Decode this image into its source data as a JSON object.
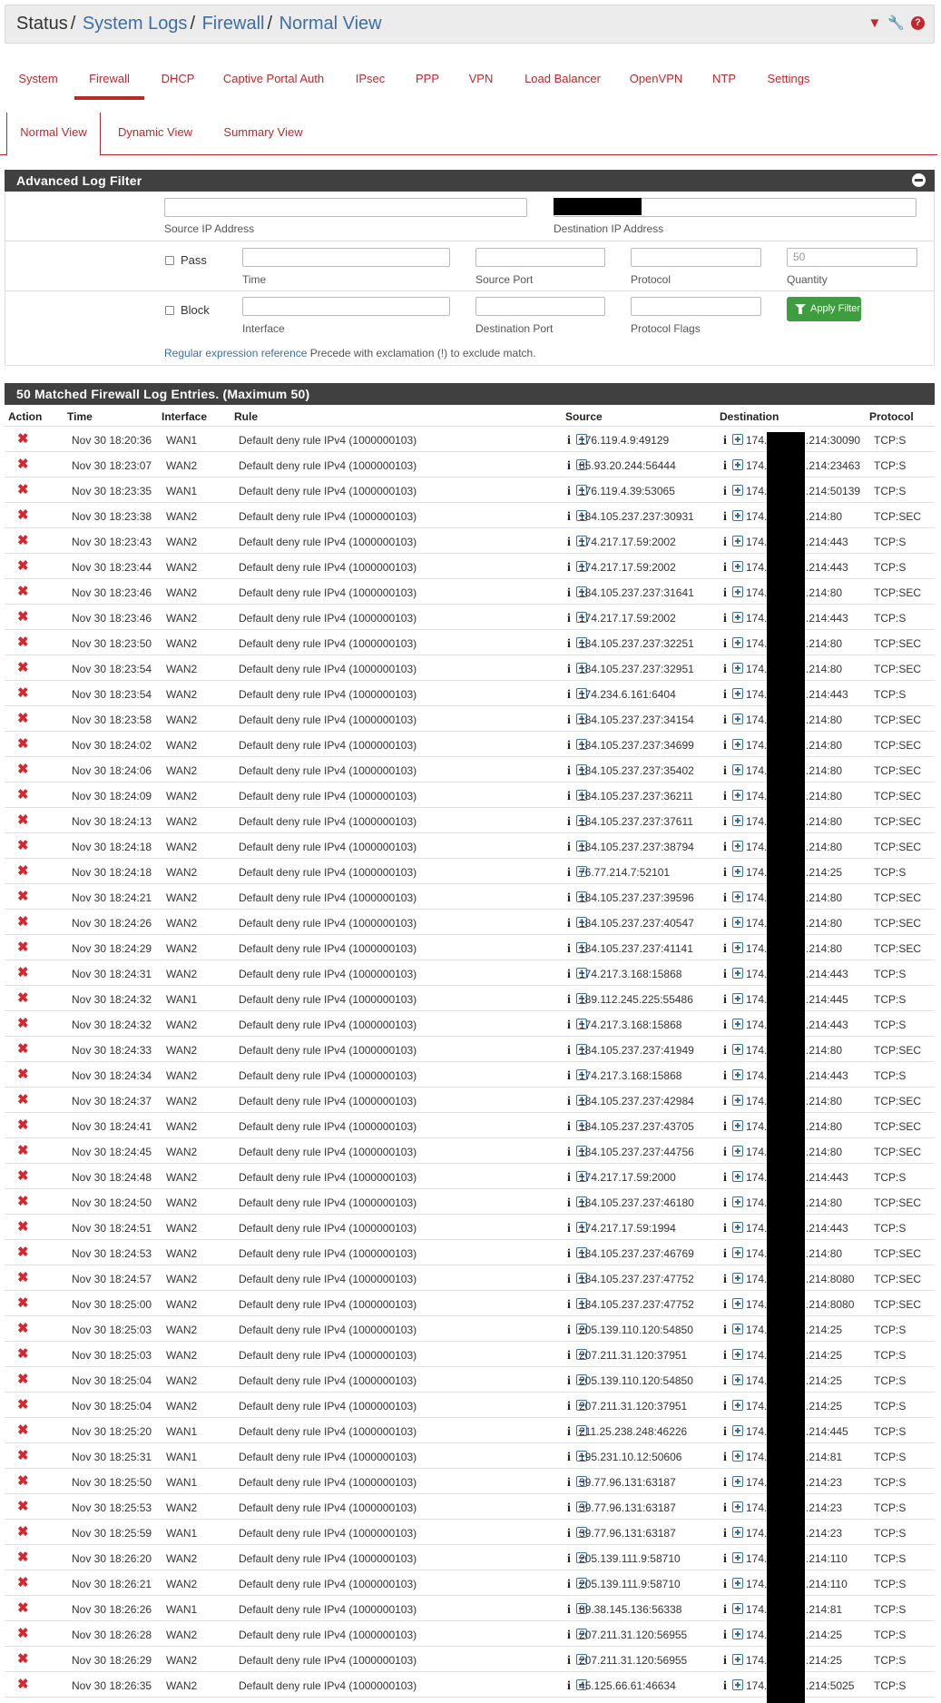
{
  "breadcrumb": {
    "status": "Status",
    "system_logs": "System Logs",
    "firewall": "Firewall",
    "normal_view": "Normal View"
  },
  "header_icons": [
    "filter-icon",
    "wrench-icon",
    "help-icon"
  ],
  "tabs": [
    "System",
    "Firewall",
    "DHCP",
    "Captive Portal Auth",
    "IPsec",
    "PPP",
    "VPN",
    "Load Balancer",
    "OpenVPN",
    "NTP",
    "Settings"
  ],
  "active_tab": "Firewall",
  "subtabs": [
    "Normal View",
    "Dynamic View",
    "Summary View"
  ],
  "active_subtab": "Normal View",
  "filter": {
    "title": "Advanced Log Filter",
    "source_ip_label": "Source IP Address",
    "destination_ip_label": "Destination IP Address",
    "pass_label": "Pass",
    "block_label": "Block",
    "time_label": "Time",
    "source_port_label": "Source Port",
    "protocol_label": "Protocol",
    "quantity_label": "Quantity",
    "quantity_placeholder": "50",
    "interface_label": "Interface",
    "destination_port_label": "Destination Port",
    "protocol_flags_label": "Protocol Flags",
    "apply_button": "Apply Filter",
    "regex_link": "Regular expression reference",
    "regex_hint": "Precede with exclamation (!) to exclude match."
  },
  "log": {
    "title": "50 Matched Firewall Log Entries. (Maximum 50)",
    "columns": [
      "Action",
      "Time",
      "Interface",
      "Rule",
      "Source",
      "Destination",
      "Protocol"
    ],
    "entries": [
      {
        "time": "Nov 30 18:20:36",
        "iface": "WAN1",
        "rule": "Default deny rule IPv4 (1000000103)",
        "src": "176.119.4.9:49129",
        "dst_prefix": "174.",
        "dst_suffix": ".214:30090",
        "proto": "TCP:S"
      },
      {
        "time": "Nov 30 18:23:07",
        "iface": "WAN2",
        "rule": "Default deny rule IPv4 (1000000103)",
        "src": "85.93.20.244:56444",
        "dst_prefix": "174.",
        "dst_suffix": ".214:23463",
        "proto": "TCP:S"
      },
      {
        "time": "Nov 30 18:23:35",
        "iface": "WAN1",
        "rule": "Default deny rule IPv4 (1000000103)",
        "src": "176.119.4.39:53065",
        "dst_prefix": "174.",
        "dst_suffix": ".214:50139",
        "proto": "TCP:S"
      },
      {
        "time": "Nov 30 18:23:38",
        "iface": "WAN2",
        "rule": "Default deny rule IPv4 (1000000103)",
        "src": "184.105.237.237:30931",
        "dst_prefix": "174.",
        "dst_suffix": ".214:80",
        "proto": "TCP:SEC"
      },
      {
        "time": "Nov 30 18:23:43",
        "iface": "WAN2",
        "rule": "Default deny rule IPv4 (1000000103)",
        "src": "174.217.17.59:2002",
        "dst_prefix": "174.",
        "dst_suffix": ".214:443",
        "proto": "TCP:S"
      },
      {
        "time": "Nov 30 18:23:44",
        "iface": "WAN2",
        "rule": "Default deny rule IPv4 (1000000103)",
        "src": "174.217.17.59:2002",
        "dst_prefix": "174.",
        "dst_suffix": ".214:443",
        "proto": "TCP:S"
      },
      {
        "time": "Nov 30 18:23:46",
        "iface": "WAN2",
        "rule": "Default deny rule IPv4 (1000000103)",
        "src": "184.105.237.237:31641",
        "dst_prefix": "174.",
        "dst_suffix": ".214:80",
        "proto": "TCP:SEC"
      },
      {
        "time": "Nov 30 18:23:46",
        "iface": "WAN2",
        "rule": "Default deny rule IPv4 (1000000103)",
        "src": "174.217.17.59:2002",
        "dst_prefix": "174.",
        "dst_suffix": ".214:443",
        "proto": "TCP:S"
      },
      {
        "time": "Nov 30 18:23:50",
        "iface": "WAN2",
        "rule": "Default deny rule IPv4 (1000000103)",
        "src": "184.105.237.237:32251",
        "dst_prefix": "174.",
        "dst_suffix": ".214:80",
        "proto": "TCP:SEC"
      },
      {
        "time": "Nov 30 18:23:54",
        "iface": "WAN2",
        "rule": "Default deny rule IPv4 (1000000103)",
        "src": "184.105.237.237:32951",
        "dst_prefix": "174.",
        "dst_suffix": ".214:80",
        "proto": "TCP:SEC"
      },
      {
        "time": "Nov 30 18:23:54",
        "iface": "WAN2",
        "rule": "Default deny rule IPv4 (1000000103)",
        "src": "174.234.6.161:6404",
        "dst_prefix": "174.",
        "dst_suffix": ".214:443",
        "proto": "TCP:S"
      },
      {
        "time": "Nov 30 18:23:58",
        "iface": "WAN2",
        "rule": "Default deny rule IPv4 (1000000103)",
        "src": "184.105.237.237:34154",
        "dst_prefix": "174.",
        "dst_suffix": ".214:80",
        "proto": "TCP:SEC"
      },
      {
        "time": "Nov 30 18:24:02",
        "iface": "WAN2",
        "rule": "Default deny rule IPv4 (1000000103)",
        "src": "184.105.237.237:34699",
        "dst_prefix": "174.",
        "dst_suffix": ".214:80",
        "proto": "TCP:SEC"
      },
      {
        "time": "Nov 30 18:24:06",
        "iface": "WAN2",
        "rule": "Default deny rule IPv4 (1000000103)",
        "src": "184.105.237.237:35402",
        "dst_prefix": "174.",
        "dst_suffix": ".214:80",
        "proto": "TCP:SEC"
      },
      {
        "time": "Nov 30 18:24:09",
        "iface": "WAN2",
        "rule": "Default deny rule IPv4 (1000000103)",
        "src": "184.105.237.237:36211",
        "dst_prefix": "174.",
        "dst_suffix": ".214:80",
        "proto": "TCP:SEC"
      },
      {
        "time": "Nov 30 18:24:13",
        "iface": "WAN2",
        "rule": "Default deny rule IPv4 (1000000103)",
        "src": "184.105.237.237:37611",
        "dst_prefix": "174.",
        "dst_suffix": ".214:80",
        "proto": "TCP:SEC"
      },
      {
        "time": "Nov 30 18:24:18",
        "iface": "WAN2",
        "rule": "Default deny rule IPv4 (1000000103)",
        "src": "184.105.237.237:38794",
        "dst_prefix": "174.",
        "dst_suffix": ".214:80",
        "proto": "TCP:SEC"
      },
      {
        "time": "Nov 30 18:24:18",
        "iface": "WAN2",
        "rule": "Default deny rule IPv4 (1000000103)",
        "src": "76.77.214.7:52101",
        "dst_prefix": "174.",
        "dst_suffix": ".214:25",
        "proto": "TCP:S"
      },
      {
        "time": "Nov 30 18:24:21",
        "iface": "WAN2",
        "rule": "Default deny rule IPv4 (1000000103)",
        "src": "184.105.237.237:39596",
        "dst_prefix": "174.",
        "dst_suffix": ".214:80",
        "proto": "TCP:SEC"
      },
      {
        "time": "Nov 30 18:24:26",
        "iface": "WAN2",
        "rule": "Default deny rule IPv4 (1000000103)",
        "src": "184.105.237.237:40547",
        "dst_prefix": "174.",
        "dst_suffix": ".214:80",
        "proto": "TCP:SEC"
      },
      {
        "time": "Nov 30 18:24:29",
        "iface": "WAN2",
        "rule": "Default deny rule IPv4 (1000000103)",
        "src": "184.105.237.237:41141",
        "dst_prefix": "174.",
        "dst_suffix": ".214:80",
        "proto": "TCP:SEC"
      },
      {
        "time": "Nov 30 18:24:31",
        "iface": "WAN2",
        "rule": "Default deny rule IPv4 (1000000103)",
        "src": "174.217.3.168:15868",
        "dst_prefix": "174.",
        "dst_suffix": ".214:443",
        "proto": "TCP:S"
      },
      {
        "time": "Nov 30 18:24:32",
        "iface": "WAN1",
        "rule": "Default deny rule IPv4 (1000000103)",
        "src": "189.112.245.225:55486",
        "dst_prefix": "174.",
        "dst_suffix": ".214:445",
        "proto": "TCP:S"
      },
      {
        "time": "Nov 30 18:24:32",
        "iface": "WAN2",
        "rule": "Default deny rule IPv4 (1000000103)",
        "src": "174.217.3.168:15868",
        "dst_prefix": "174.",
        "dst_suffix": ".214:443",
        "proto": "TCP:S"
      },
      {
        "time": "Nov 30 18:24:33",
        "iface": "WAN2",
        "rule": "Default deny rule IPv4 (1000000103)",
        "src": "184.105.237.237:41949",
        "dst_prefix": "174.",
        "dst_suffix": ".214:80",
        "proto": "TCP:SEC"
      },
      {
        "time": "Nov 30 18:24:34",
        "iface": "WAN2",
        "rule": "Default deny rule IPv4 (1000000103)",
        "src": "174.217.3.168:15868",
        "dst_prefix": "174.",
        "dst_suffix": ".214:443",
        "proto": "TCP:S"
      },
      {
        "time": "Nov 30 18:24:37",
        "iface": "WAN2",
        "rule": "Default deny rule IPv4 (1000000103)",
        "src": "184.105.237.237:42984",
        "dst_prefix": "174.",
        "dst_suffix": ".214:80",
        "proto": "TCP:SEC"
      },
      {
        "time": "Nov 30 18:24:41",
        "iface": "WAN2",
        "rule": "Default deny rule IPv4 (1000000103)",
        "src": "184.105.237.237:43705",
        "dst_prefix": "174.",
        "dst_suffix": ".214:80",
        "proto": "TCP:SEC"
      },
      {
        "time": "Nov 30 18:24:45",
        "iface": "WAN2",
        "rule": "Default deny rule IPv4 (1000000103)",
        "src": "184.105.237.237:44756",
        "dst_prefix": "174.",
        "dst_suffix": ".214:80",
        "proto": "TCP:SEC"
      },
      {
        "time": "Nov 30 18:24:48",
        "iface": "WAN2",
        "rule": "Default deny rule IPv4 (1000000103)",
        "src": "174.217.17.59:2000",
        "dst_prefix": "174.",
        "dst_suffix": ".214:443",
        "proto": "TCP:S"
      },
      {
        "time": "Nov 30 18:24:50",
        "iface": "WAN2",
        "rule": "Default deny rule IPv4 (1000000103)",
        "src": "184.105.237.237:46180",
        "dst_prefix": "174.",
        "dst_suffix": ".214:80",
        "proto": "TCP:SEC"
      },
      {
        "time": "Nov 30 18:24:51",
        "iface": "WAN2",
        "rule": "Default deny rule IPv4 (1000000103)",
        "src": "174.217.17.59:1994",
        "dst_prefix": "174.",
        "dst_suffix": ".214:443",
        "proto": "TCP:S"
      },
      {
        "time": "Nov 30 18:24:53",
        "iface": "WAN2",
        "rule": "Default deny rule IPv4 (1000000103)",
        "src": "184.105.237.237:46769",
        "dst_prefix": "174.",
        "dst_suffix": ".214:80",
        "proto": "TCP:SEC"
      },
      {
        "time": "Nov 30 18:24:57",
        "iface": "WAN2",
        "rule": "Default deny rule IPv4 (1000000103)",
        "src": "184.105.237.237:47752",
        "dst_prefix": "174.",
        "dst_suffix": ".214:8080",
        "proto": "TCP:SEC"
      },
      {
        "time": "Nov 30 18:25:00",
        "iface": "WAN2",
        "rule": "Default deny rule IPv4 (1000000103)",
        "src": "184.105.237.237:47752",
        "dst_prefix": "174.",
        "dst_suffix": ".214:8080",
        "proto": "TCP:SEC"
      },
      {
        "time": "Nov 30 18:25:03",
        "iface": "WAN2",
        "rule": "Default deny rule IPv4 (1000000103)",
        "src": "205.139.110.120:54850",
        "dst_prefix": "174.",
        "dst_suffix": ".214:25",
        "proto": "TCP:S"
      },
      {
        "time": "Nov 30 18:25:03",
        "iface": "WAN2",
        "rule": "Default deny rule IPv4 (1000000103)",
        "src": "207.211.31.120:37951",
        "dst_prefix": "174.",
        "dst_suffix": ".214:25",
        "proto": "TCP:S"
      },
      {
        "time": "Nov 30 18:25:04",
        "iface": "WAN2",
        "rule": "Default deny rule IPv4 (1000000103)",
        "src": "205.139.110.120:54850",
        "dst_prefix": "174.",
        "dst_suffix": ".214:25",
        "proto": "TCP:S"
      },
      {
        "time": "Nov 30 18:25:04",
        "iface": "WAN2",
        "rule": "Default deny rule IPv4 (1000000103)",
        "src": "207.211.31.120:37951",
        "dst_prefix": "174.",
        "dst_suffix": ".214:25",
        "proto": "TCP:S"
      },
      {
        "time": "Nov 30 18:25:20",
        "iface": "WAN1",
        "rule": "Default deny rule IPv4 (1000000103)",
        "src": "211.25.238.248:46226",
        "dst_prefix": "174.",
        "dst_suffix": ".214:445",
        "proto": "TCP:S"
      },
      {
        "time": "Nov 30 18:25:31",
        "iface": "WAN1",
        "rule": "Default deny rule IPv4 (1000000103)",
        "src": "195.231.10.12:50606",
        "dst_prefix": "174.",
        "dst_suffix": ".214:81",
        "proto": "TCP:S"
      },
      {
        "time": "Nov 30 18:25:50",
        "iface": "WAN1",
        "rule": "Default deny rule IPv4 (1000000103)",
        "src": "39.77.96.131:63187",
        "dst_prefix": "174.",
        "dst_suffix": ".214:23",
        "proto": "TCP:S"
      },
      {
        "time": "Nov 30 18:25:53",
        "iface": "WAN2",
        "rule": "Default deny rule IPv4 (1000000103)",
        "src": "39.77.96.131:63187",
        "dst_prefix": "174.",
        "dst_suffix": ".214:23",
        "proto": "TCP:S"
      },
      {
        "time": "Nov 30 18:25:59",
        "iface": "WAN1",
        "rule": "Default deny rule IPv4 (1000000103)",
        "src": "39.77.96.131:63187",
        "dst_prefix": "174.",
        "dst_suffix": ".214:23",
        "proto": "TCP:S"
      },
      {
        "time": "Nov 30 18:26:20",
        "iface": "WAN2",
        "rule": "Default deny rule IPv4 (1000000103)",
        "src": "205.139.111.9:58710",
        "dst_prefix": "174.",
        "dst_suffix": ".214:110",
        "proto": "TCP:S"
      },
      {
        "time": "Nov 30 18:26:21",
        "iface": "WAN2",
        "rule": "Default deny rule IPv4 (1000000103)",
        "src": "205.139.111.9:58710",
        "dst_prefix": "174.",
        "dst_suffix": ".214:110",
        "proto": "TCP:S"
      },
      {
        "time": "Nov 30 18:26:26",
        "iface": "WAN1",
        "rule": "Default deny rule IPv4 (1000000103)",
        "src": "89.38.145.136:56338",
        "dst_prefix": "174.",
        "dst_suffix": ".214:81",
        "proto": "TCP:S"
      },
      {
        "time": "Nov 30 18:26:28",
        "iface": "WAN2",
        "rule": "Default deny rule IPv4 (1000000103)",
        "src": "207.211.31.120:56955",
        "dst_prefix": "174.",
        "dst_suffix": ".214:25",
        "proto": "TCP:S"
      },
      {
        "time": "Nov 30 18:26:29",
        "iface": "WAN2",
        "rule": "Default deny rule IPv4 (1000000103)",
        "src": "207.211.31.120:56955",
        "dst_prefix": "174.",
        "dst_suffix": ".214:25",
        "proto": "TCP:S"
      },
      {
        "time": "Nov 30 18:26:35",
        "iface": "WAN2",
        "rule": "Default deny rule IPv4 (1000000103)",
        "src": "45.125.66.61:46634",
        "dst_prefix": "174.",
        "dst_suffix": ".214:5025",
        "proto": "TCP:S"
      }
    ]
  }
}
